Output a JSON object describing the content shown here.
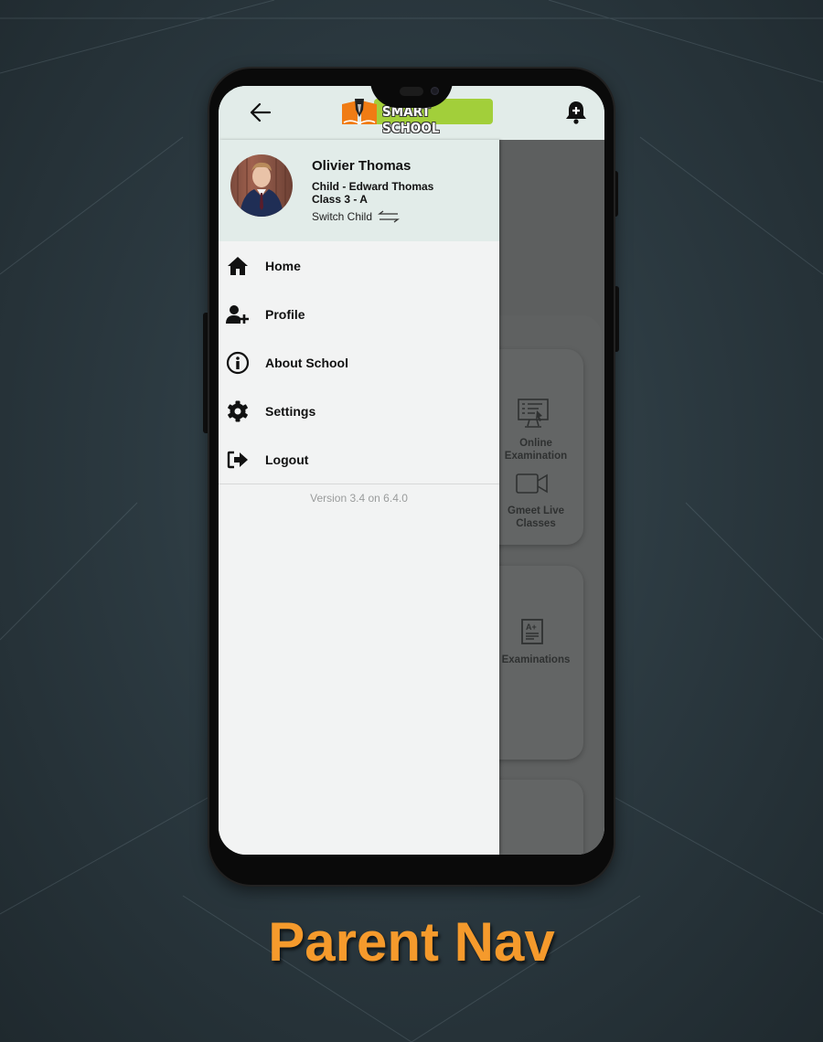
{
  "colors": {
    "accent_orange": "#f59a2c",
    "logo_green": "#a2cf3a",
    "header_bg": "#e2ece9",
    "drawer_bg": "#f2f3f3",
    "scrim": "#5d5f5f"
  },
  "app_bar": {
    "back_icon": "arrow-left-icon",
    "logo_text": "SMART SCHOOL",
    "notification_icon": "bell-plus-icon"
  },
  "drawer": {
    "user": {
      "name": "Olivier Thomas",
      "child": "Child - Edward Thomas",
      "class": "Class 3 - A",
      "switch_label": "Switch Child",
      "switch_icon": "swap-arrows-icon"
    },
    "menu": [
      {
        "label": "Home",
        "icon": "home-icon"
      },
      {
        "label": "Profile",
        "icon": "user-plus-icon"
      },
      {
        "label": "About School",
        "icon": "info-icon"
      },
      {
        "label": "Settings",
        "icon": "gear-icon"
      },
      {
        "label": "Logout",
        "icon": "logout-icon"
      }
    ],
    "version": "Version 3.4 on 6.4.0"
  },
  "background_screen": {
    "items": [
      {
        "label_line1": "Online",
        "label_line2": "Examination",
        "icon": "online-exam-icon"
      },
      {
        "label_line1": "Gmeet Live",
        "label_line2": "Classes",
        "icon": "video-camera-icon"
      },
      {
        "label_line1": "Examinations",
        "label_line2": "",
        "icon": "grade-report-icon"
      }
    ]
  },
  "caption": "Parent Nav"
}
